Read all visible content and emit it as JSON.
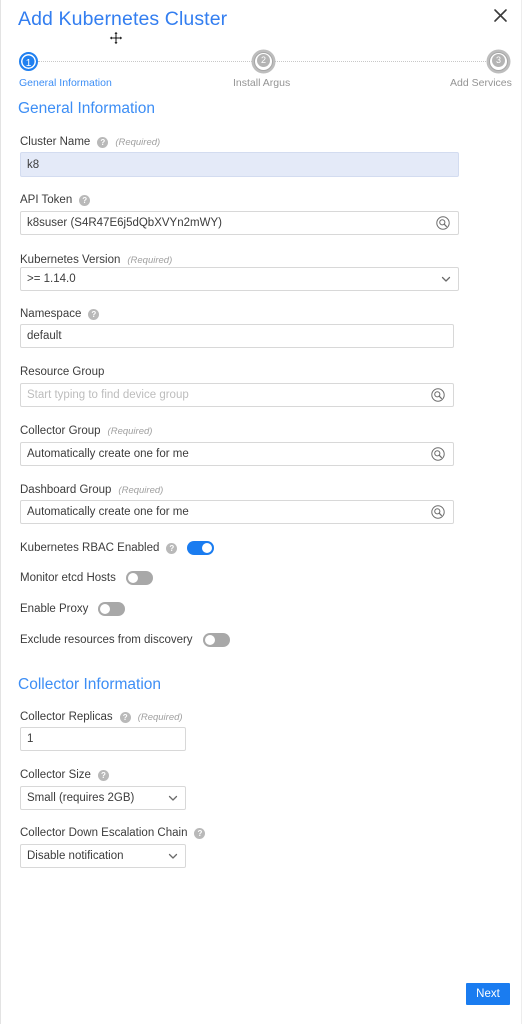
{
  "dialog": {
    "title": "Add Kubernetes Cluster",
    "close_icon": "close-icon",
    "cursor_icon": "move-cursor-icon"
  },
  "stepper": {
    "steps": [
      {
        "number": "1",
        "label": "General Information",
        "state": "active"
      },
      {
        "number": "2",
        "label": "Install Argus",
        "state": "inactive"
      },
      {
        "number": "3",
        "label": "Add Services",
        "state": "inactive"
      }
    ]
  },
  "sections": {
    "general": {
      "title": "General Information"
    },
    "collector": {
      "title": "Collector Information"
    }
  },
  "fields": {
    "cluster_name": {
      "label": "Cluster Name",
      "required_note": "(Required)",
      "value": "k8",
      "placeholder": ""
    },
    "api_token": {
      "label": "API Token",
      "value": "k8suser (S4R47E6j5dQbXVYn2mWY)",
      "placeholder": "",
      "icon": "search-icon"
    },
    "kubernetes_version": {
      "label": "Kubernetes Version",
      "required_note": "(Required)",
      "value": ">= 1.14.0",
      "icon": "chevron-down-icon"
    },
    "namespace": {
      "label": "Namespace",
      "value": "default",
      "placeholder": ""
    },
    "resource_group": {
      "label": "Resource Group",
      "value": "",
      "placeholder": "Start typing to find device group",
      "icon": "search-icon"
    },
    "collector_group": {
      "label": "Collector Group",
      "required_note": "(Required)",
      "value": "Automatically create one for me",
      "icon": "search-icon"
    },
    "dashboard_group": {
      "label": "Dashboard Group",
      "required_note": "(Required)",
      "value": "Automatically create one for me",
      "icon": "search-icon"
    },
    "collector_replicas": {
      "label": "Collector Replicas",
      "required_note": "(Required)",
      "value": "1"
    },
    "collector_size": {
      "label": "Collector Size",
      "value": "Small (requires 2GB)",
      "icon": "chevron-down-icon"
    },
    "escalation_chain": {
      "label": "Collector Down Escalation Chain",
      "value": "Disable notification",
      "icon": "chevron-down-icon"
    }
  },
  "toggles": {
    "rbac": {
      "label": "Kubernetes RBAC Enabled",
      "state": "on"
    },
    "etcd": {
      "label": "Monitor etcd Hosts",
      "state": "off"
    },
    "proxy": {
      "label": "Enable Proxy",
      "state": "off"
    },
    "exclude": {
      "label": "Exclude resources from discovery",
      "state": "off"
    }
  },
  "footer": {
    "next_label": "Next"
  },
  "colors": {
    "accent": "#1a7cf0",
    "title": "#337ef0",
    "section_title": "#3d8ef5",
    "toggle_off": "#a8a8a8",
    "highlight_bg": "#e4eaf8"
  }
}
